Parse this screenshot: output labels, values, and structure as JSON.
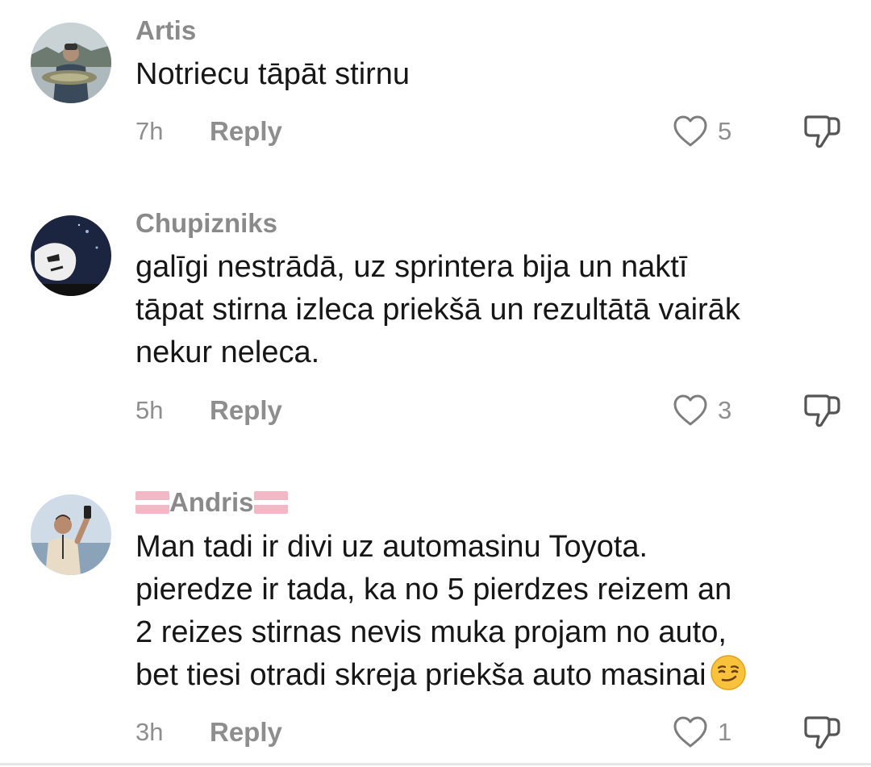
{
  "comments": [
    {
      "username": "Artis",
      "text_lines": [
        "Notriecu tāpāt stirnu"
      ],
      "time": "7h",
      "reply_label": "Reply",
      "likes": "5"
    },
    {
      "username": "Chupizniks",
      "text_lines": [
        "galīgi nestrādā, uz sprintera bija un naktī",
        "tāpat stirna izleca priekšā un rezultātā vairāk",
        "nekur neleca."
      ],
      "time": "5h",
      "reply_label": "Reply",
      "likes": "3"
    },
    {
      "username": "Andris",
      "text_lines": [
        "Man tadi ir divi uz automasinu Toyota.",
        "pieredze ir tada, ka no 5 pierdzes reizem an",
        "2 reizes stirnas nevis muka projam no auto,",
        "bet tiesi otradi skreja priekša auto masinai"
      ],
      "time": "3h",
      "reply_label": "Reply",
      "likes": "1"
    }
  ],
  "icons": {
    "like": "heart-outline-icon",
    "dislike": "thumbs-down-icon",
    "flag": "latvia-flag-icon",
    "emoji": "smirking-face-emoji"
  },
  "colors": {
    "username": "#8a8a8a",
    "text": "#161616",
    "meta": "#8e8e8e",
    "flag_red": "#f2b8c6"
  }
}
